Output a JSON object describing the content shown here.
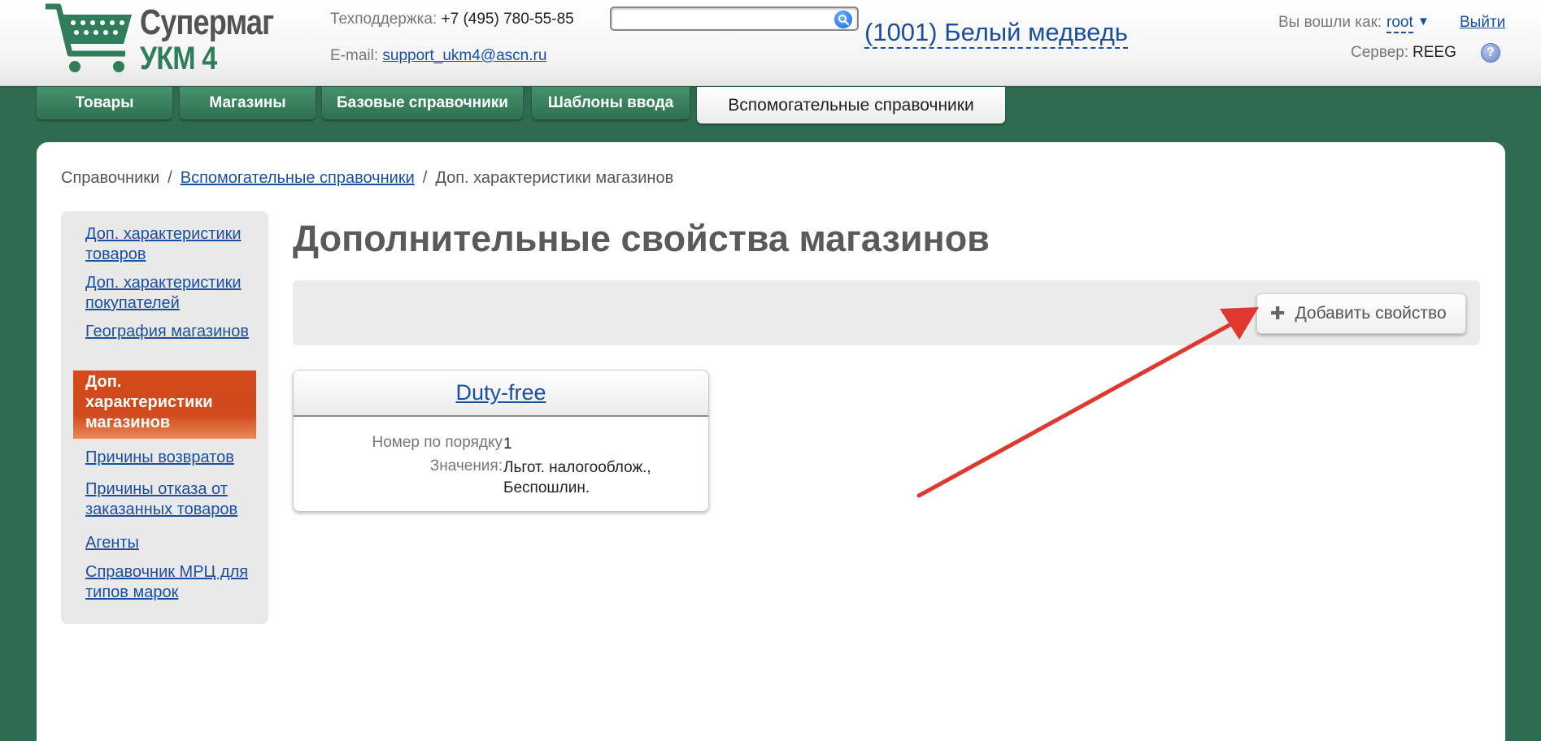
{
  "header": {
    "logo_line1": "Супермаг",
    "logo_line2": "УКМ 4",
    "support_label": "Техподдержка:",
    "support_phone": "+7 (495) 780-55-85",
    "email_label": "E-mail:",
    "email": "support_ukm4@ascn.ru",
    "search_value": "",
    "store": "(1001) Белый медведь",
    "login_label": "Вы вошли как:",
    "login_user": "root",
    "logout": "Выйти",
    "server_label": "Сервер:",
    "server_value": "REEG",
    "help": "?"
  },
  "tabs": [
    {
      "label": "Товары"
    },
    {
      "label": "Магазины"
    },
    {
      "label": "Базовые справочники"
    },
    {
      "label": "Шаблоны ввода"
    },
    {
      "label": "Вспомогательные справочники",
      "active": true
    }
  ],
  "breadcrumb": {
    "root": "Справочники",
    "parent": "Вспомогательные справочники",
    "current": "Доп. характеристики магазинов"
  },
  "sidebar": {
    "items": [
      {
        "label": "Доп. характеристики товаров"
      },
      {
        "label": "Доп. характеристики покупателей"
      },
      {
        "label": "География магазинов"
      },
      {
        "label": "Доп. характеристики магазинов",
        "active": true
      },
      {
        "label": "Причины возвратов"
      },
      {
        "label": "Причины отказа от заказанных товаров"
      },
      {
        "label": "Агенты"
      },
      {
        "label": "Справочник МРЦ для типов марок"
      }
    ]
  },
  "main": {
    "title": "Дополнительные свойства магазинов",
    "add_button": "Добавить свойство",
    "card": {
      "title": "Duty-free",
      "order_label": "Номер по порядку",
      "order_value": "1",
      "values_label": "Значения:",
      "values_value": "Льгот. налогооблож., Беспошлин."
    }
  },
  "colors": {
    "brand_green": "#2f6b50",
    "link_blue": "#1a4fa0",
    "active_orange": "#d44a1a",
    "annotation_arrow": "#e0382e"
  }
}
